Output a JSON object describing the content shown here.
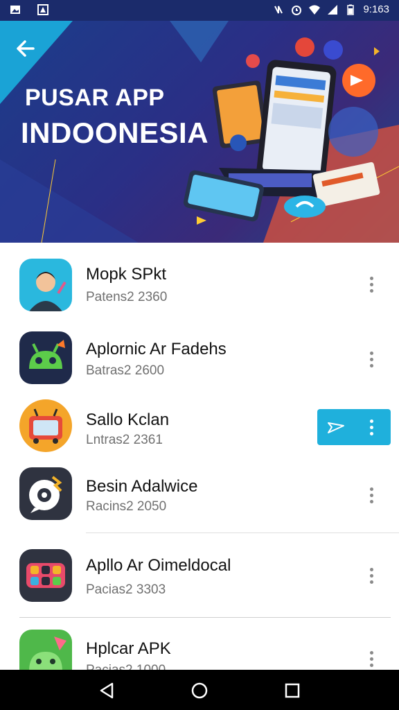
{
  "status_bar": {
    "time": "9:163"
  },
  "hero": {
    "title_line1": "PUSAR APP",
    "title_line2": "INDOONESIA"
  },
  "apps": [
    {
      "name": "Mopk SPkt",
      "subtitle": "Patens2 2360"
    },
    {
      "name": "Aplornic Ar Fadehs",
      "subtitle": "Batras2 2600"
    },
    {
      "name": "Sallo Kclan",
      "subtitle": "Lntras2 2361"
    },
    {
      "name": "Besin Adalwice",
      "subtitle": "Racins2 2050"
    },
    {
      "name": "Apllo Ar Oimeldocal",
      "subtitle": "Pacias2 3303"
    },
    {
      "name": "Hplcar APK",
      "subtitle": "Pacias2 1000"
    }
  ],
  "colors": {
    "accent": "#1fb0dc",
    "status_bar": "#1b2b6b",
    "navbar": "#000000"
  },
  "icons": [
    "back-arrow-icon",
    "wifi-icon",
    "signal-icon",
    "battery-icon",
    "send-icon",
    "more-vert-icon",
    "nav-back-icon",
    "nav-home-icon",
    "nav-recents-icon"
  ]
}
